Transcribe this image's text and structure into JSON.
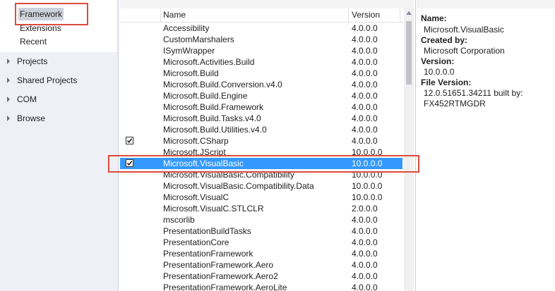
{
  "nav": {
    "tree_items": [
      {
        "label": "Framework"
      },
      {
        "label": "Extensions"
      },
      {
        "label": "Recent"
      }
    ],
    "categories": [
      {
        "label": "Projects"
      },
      {
        "label": "Shared Projects"
      },
      {
        "label": "COM"
      },
      {
        "label": "Browse"
      }
    ]
  },
  "list": {
    "columns": {
      "name": "Name",
      "version": "Version"
    },
    "rows": [
      {
        "name": "Accessibility",
        "version": "4.0.0.0",
        "checked": false
      },
      {
        "name": "CustomMarshalers",
        "version": "4.0.0.0",
        "checked": false
      },
      {
        "name": "ISymWrapper",
        "version": "4.0.0.0",
        "checked": false
      },
      {
        "name": "Microsoft.Activities.Build",
        "version": "4.0.0.0",
        "checked": false
      },
      {
        "name": "Microsoft.Build",
        "version": "4.0.0.0",
        "checked": false
      },
      {
        "name": "Microsoft.Build.Conversion.v4.0",
        "version": "4.0.0.0",
        "checked": false
      },
      {
        "name": "Microsoft.Build.Engine",
        "version": "4.0.0.0",
        "checked": false
      },
      {
        "name": "Microsoft.Build.Framework",
        "version": "4.0.0.0",
        "checked": false
      },
      {
        "name": "Microsoft.Build.Tasks.v4.0",
        "version": "4.0.0.0",
        "checked": false
      },
      {
        "name": "Microsoft.Build.Utilities.v4.0",
        "version": "4.0.0.0",
        "checked": false
      },
      {
        "name": "Microsoft.CSharp",
        "version": "4.0.0.0",
        "checked": true
      },
      {
        "name": "Microsoft.JScript",
        "version": "10.0.0.0",
        "checked": false
      },
      {
        "name": "Microsoft.VisualBasic",
        "version": "10.0.0.0",
        "checked": true,
        "selected": true
      },
      {
        "name": "Microsoft.VisualBasic.Compatibility",
        "version": "10.0.0.0",
        "checked": false
      },
      {
        "name": "Microsoft.VisualBasic.Compatibility.Data",
        "version": "10.0.0.0",
        "checked": false
      },
      {
        "name": "Microsoft.VisualC",
        "version": "10.0.0.0",
        "checked": false
      },
      {
        "name": "Microsoft.VisualC.STLCLR",
        "version": "2.0.0.0",
        "checked": false
      },
      {
        "name": "mscorlib",
        "version": "4.0.0.0",
        "checked": false
      },
      {
        "name": "PresentationBuildTasks",
        "version": "4.0.0.0",
        "checked": false
      },
      {
        "name": "PresentationCore",
        "version": "4.0.0.0",
        "checked": false
      },
      {
        "name": "PresentationFramework",
        "version": "4.0.0.0",
        "checked": false
      },
      {
        "name": "PresentationFramework.Aero",
        "version": "4.0.0.0",
        "checked": false
      },
      {
        "name": "PresentationFramework.Aero2",
        "version": "4.0.0.0",
        "checked": false
      },
      {
        "name": "PresentationFramework.AeroLite",
        "version": "4.0.0.0",
        "checked": false
      }
    ]
  },
  "details": {
    "name_label": "Name:",
    "name_value": "Microsoft.VisualBasic",
    "created_label": "Created by:",
    "created_value": "Microsoft Corporation",
    "version_label": "Version:",
    "version_value": "10.0.0.0",
    "file_version_label": "File Version:",
    "file_version_value_1": "12.0.51651.34211 built by:",
    "file_version_value_2": "FX452RTMGDR"
  },
  "colors": {
    "selection": "#3399ff",
    "highlight_box": "#dc4b3e",
    "nav_background": "#eef0f6"
  }
}
